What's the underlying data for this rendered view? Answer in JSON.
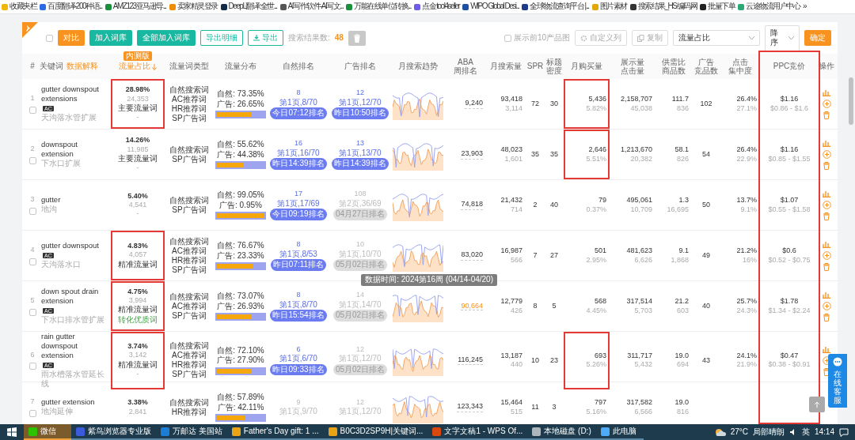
{
  "bookmarks": [
    {
      "label": "收藏夹栏",
      "color": "#f2b705"
    },
    {
      "label": "百度翻译-200种语...",
      "color": "#2d6be4"
    },
    {
      "label": "AMZ123亚马逊导...",
      "color": "#1a8f3c"
    },
    {
      "label": "卖家精灵登录",
      "color": "#f08c00"
    },
    {
      "label": "DeepL翻译:全世...",
      "color": "#0f2b46"
    },
    {
      "label": "AI写作软件-AI写文...",
      "color": "#555555"
    },
    {
      "label": "万能在线单位转换...",
      "color": "#1a8f3c"
    },
    {
      "label": "点金 tool4seller",
      "color": "#6c5ce7"
    },
    {
      "label": "WIPO Global Desi...",
      "color": "#1e4fa0"
    },
    {
      "label": "全球物流查询平台 |...",
      "color": "#1e3a8a"
    },
    {
      "label": "图片素材",
      "color": "#e0a800"
    },
    {
      "label": "搜索结果_HS编码网",
      "color": "#333333"
    },
    {
      "label": "批量下单",
      "color": "#222222"
    },
    {
      "label": "云途物流用户中心",
      "color": "#2aa876"
    }
  ],
  "bookmarks_more": "»",
  "toolbar": {
    "select_all": {
      "checked": false
    },
    "buttons": [
      {
        "label": "对比",
        "kind": "orange"
      },
      {
        "label": "加入词库",
        "kind": "teal"
      },
      {
        "label": "全部加入词库",
        "kind": "teal"
      },
      {
        "label": "导出明细",
        "kind": "outline"
      },
      {
        "label": "导出",
        "kind": "outline-download"
      }
    ],
    "result_label": "搜索结果数:",
    "result_count": "48",
    "show_images": {
      "label": "展示前10产品图",
      "checked": false
    },
    "custom_columns": "自定义列",
    "copy": "复制",
    "sort_field": "流量占比",
    "sort_order": "降序",
    "confirm": "确定"
  },
  "header": [
    {
      "lines": [
        "#"
      ]
    },
    {
      "lines": [
        "关键词"
      ],
      "extra": "数据解释"
    },
    {
      "lines": [
        "流量占比"
      ],
      "badge": "内测版",
      "sorted": true
    },
    {
      "lines": [
        "流量词类型"
      ]
    },
    {
      "lines": [
        "流量分布"
      ]
    },
    {
      "lines": [
        "自然排名"
      ]
    },
    {
      "lines": [
        "广告排名"
      ]
    },
    {
      "lines": [
        "月搜索趋势"
      ]
    },
    {
      "lines": [
        "ABA",
        "周排名"
      ]
    },
    {
      "lines": [
        "月搜索量"
      ]
    },
    {
      "lines": [
        "SPR"
      ]
    },
    {
      "lines": [
        "标题",
        "密度"
      ]
    },
    {
      "lines": [
        "月购买量"
      ]
    },
    {
      "lines": [
        "展示量",
        "点击量"
      ]
    },
    {
      "lines": [
        "供需比",
        "商品数"
      ]
    },
    {
      "lines": [
        "广告",
        "竞品数"
      ]
    },
    {
      "lines": [
        "点击",
        "集中度"
      ]
    },
    {
      "lines": [
        "PPC竞价"
      ],
      "marked": true
    },
    {
      "lines": [
        "操作"
      ]
    }
  ],
  "rows": [
    {
      "index": "1",
      "checked": false,
      "keyword": "gutter downspout extensions",
      "ac_badge": "AC",
      "keyword_cn": "天沟落水管扩展",
      "share": "28.98%",
      "share_count": "24,353",
      "traffic_label": "主要流量词",
      "extra": {
        "kind": "dash",
        "text": "-"
      },
      "share_marked": true,
      "types": [
        "自然搜索词",
        "AC推荐词",
        "HR推荐词",
        "SP广告词"
      ],
      "organic_label": "自然:",
      "organic": "73.35%",
      "ad_label": "广告:",
      "ad": "26.65%",
      "level": 0.7335,
      "natural_rank": {
        "rank": "8",
        "page": "第1页,8/70",
        "badge": "今日07:12排名",
        "current": true
      },
      "ad_rank": {
        "rank": "12",
        "page": "第1页,12/70",
        "badge": "昨日10:50排名",
        "current": true
      },
      "aba": "9,240",
      "search": "93,418",
      "search_sub": "3,114",
      "spr": "72",
      "title_density": "30",
      "buy": "5,436",
      "buy_rate": "5.82%",
      "buy_marked": true,
      "impressions": "2,158,707",
      "clicks": "45,038",
      "supply_ratio": "111.7",
      "products": "836",
      "ad_products": "102",
      "click_conc": "26.4%",
      "click_conc_sub": "27.1%",
      "ppc": "$1.16",
      "ppc_range": "$0.86 - $1.6"
    },
    {
      "index": "2",
      "checked": false,
      "keyword": "downspout extension",
      "keyword_cn": "下水口扩展",
      "share": "14.26%",
      "share_count": "11,985",
      "traffic_label": "主要流量词",
      "extra": {
        "kind": "dash",
        "text": "-"
      },
      "share_marked": false,
      "types": [
        "自然搜索词",
        "SP广告词"
      ],
      "organic_label": "自然:",
      "organic": "55.62%",
      "ad_label": "广告:",
      "ad": "44.38%",
      "level": 0.5562,
      "natural_rank": {
        "rank": "16",
        "page": "第1页,16/70",
        "badge": "昨日14:39排名",
        "current": true
      },
      "ad_rank": {
        "rank": "13",
        "page": "第1页,13/70",
        "badge": "昨日14:39排名",
        "current": true
      },
      "aba": "23,903",
      "search": "48,023",
      "search_sub": "1,601",
      "spr": "35",
      "title_density": "35",
      "buy": "2,646",
      "buy_rate": "5.51%",
      "buy_marked": true,
      "impressions": "1,213,670",
      "clicks": "20,382",
      "supply_ratio": "58.1",
      "products": "826",
      "ad_products": "54",
      "click_conc": "26.4%",
      "click_conc_sub": "22.9%",
      "ppc": "$1.16",
      "ppc_range": "$0.85 - $1.55"
    },
    {
      "index": "3",
      "checked": false,
      "keyword": "gutter",
      "keyword_cn": "地沟",
      "share": "5.40%",
      "share_count": "4,541",
      "extra": {
        "kind": "dash",
        "text": "-"
      },
      "share_marked": false,
      "types": [
        "自然搜索词",
        "SP广告词"
      ],
      "organic_label": "自然:",
      "organic": "99.05%",
      "ad_label": "广告:",
      "ad": "0.95%",
      "level": 0.9905,
      "natural_rank": {
        "rank": "17",
        "page": "第1页,17/69",
        "badge": "今日09:19排名",
        "current": true
      },
      "ad_rank": {
        "rank": "108",
        "page": "第2页,36/69",
        "badge": "04月27日排名",
        "current": false
      },
      "aba": "74,818",
      "search": "21,432",
      "search_sub": "714",
      "spr": "2",
      "title_density": "40",
      "buy": "79",
      "buy_rate": "0.37%",
      "buy_marked": false,
      "impressions": "495,061",
      "clicks": "10,709",
      "supply_ratio": "1.3",
      "products": "16,695",
      "ad_products": "50",
      "click_conc": "13.7%",
      "click_conc_sub": "9.1%",
      "ppc": "$1.07",
      "ppc_range": "$0.55 - $1.58"
    },
    {
      "index": "4",
      "checked": false,
      "keyword": "gutter downspout",
      "ac_badge": "AC",
      "keyword_cn": "天沟落水口",
      "share": "4.83%",
      "share_count": "4,057",
      "traffic_label": "精准流量词",
      "share_marked": true,
      "types": [
        "自然搜索词",
        "AC推荐词",
        "HR推荐词",
        "SP广告词"
      ],
      "organic_label": "自然:",
      "organic": "76.67%",
      "ad_label": "广告:",
      "ad": "23.33%",
      "level": 0.7667,
      "natural_rank": {
        "rank": "8",
        "page": "第1页,8/53",
        "badge": "昨日07:11排名",
        "current": true
      },
      "ad_rank": {
        "rank": "10",
        "page": "第1页,10/70",
        "badge": "05月02日排名",
        "current": false
      },
      "aba": "83,020",
      "search": "16,987",
      "search_sub": "566",
      "spr": "7",
      "title_density": "27",
      "buy": "501",
      "buy_rate": "2.95%",
      "buy_marked": false,
      "impressions": "481,623",
      "clicks": "6,626",
      "supply_ratio": "9.1",
      "products": "1,868",
      "ad_products": "49",
      "click_conc": "21.2%",
      "click_conc_sub": "16%",
      "ppc": "$0.6",
      "ppc_range": "$0.52 - $0.75"
    },
    {
      "index": "5",
      "checked": false,
      "keyword": "down spout drain extension",
      "ac_badge": "AC",
      "keyword_cn": "下水口排水管扩展",
      "share": "4.75%",
      "share_count": "3,994",
      "traffic_label": "精准流量词",
      "extra": {
        "kind": "quality",
        "text": "转化优质词"
      },
      "share_marked": true,
      "types": [
        "自然搜索词",
        "AC推荐词",
        "SP广告词"
      ],
      "organic_label": "自然:",
      "organic": "73.07%",
      "ad_label": "广告:",
      "ad": "26.93%",
      "level": 0.7307,
      "natural_rank": {
        "rank": "8",
        "page": "第1页,8/70",
        "badge": "昨日15:54排名",
        "current": true
      },
      "ad_rank": {
        "rank": "14",
        "page": "第1页,14/70",
        "badge": "05月02日排名",
        "current": false
      },
      "aba": "90,664",
      "aba_hovered": true,
      "aba_tooltip": "数据时间: 2024第16周 (04/14-04/20)",
      "search": "12,779",
      "search_sub": "426",
      "spr": "8",
      "title_density": "5",
      "buy": "568",
      "buy_rate": "4.45%",
      "buy_marked": false,
      "impressions": "317,514",
      "clicks": "5,703",
      "supply_ratio": "21.2",
      "products": "603",
      "ad_products": "40",
      "click_conc": "25.7%",
      "click_conc_sub": "24.3%",
      "ppc": "$1.78",
      "ppc_range": "$1.34 - $2.24"
    },
    {
      "index": "6",
      "checked": false,
      "keyword": "rain gutter downspout extension",
      "ac_badge": "AC",
      "keyword_cn": "雨水槽落水管延长线",
      "share": "3.74%",
      "share_count": "3,142",
      "traffic_label": "精准流量词",
      "extra": {
        "kind": "dash",
        "text": "-"
      },
      "share_marked": true,
      "types": [
        "自然搜索词",
        "AC推荐词",
        "HR推荐词",
        "SP广告词"
      ],
      "organic_label": "自然:",
      "organic": "72.10%",
      "ad_label": "广告:",
      "ad": "27.90%",
      "level": 0.721,
      "natural_rank": {
        "rank": "6",
        "page": "第1页,6/70",
        "badge": "昨日09:33排名",
        "current": true
      },
      "ad_rank": {
        "rank": "12",
        "page": "第1页,12/70",
        "badge": "05月02日排名",
        "current": false
      },
      "aba": "116,245",
      "search": "13,187",
      "search_sub": "440",
      "spr": "10",
      "title_density": "23",
      "buy": "693",
      "buy_rate": "5.26%",
      "buy_marked": true,
      "impressions": "311,717",
      "clicks": "5,432",
      "supply_ratio": "19.0",
      "products": "694",
      "ad_products": "43",
      "click_conc": "24.1%",
      "click_conc_sub": "21.9%",
      "ppc": "$0.47",
      "ppc_range": "$0.38 - $0.91"
    },
    {
      "index": "7",
      "checked": false,
      "keyword": "gutter extension",
      "keyword_cn": "地沟延伸",
      "share": "3.38%",
      "share_count": "2,841",
      "share_marked": false,
      "types": [
        "自然搜索词",
        "HR推荐词"
      ],
      "organic_label": "自然:",
      "organic": "57.89%",
      "ad_label": "广告:",
      "ad": "42.11%",
      "level": 0.5789,
      "natural_rank": {
        "rank": "9",
        "page": "第1页,9/70",
        "current": false
      },
      "ad_rank": {
        "rank": "12",
        "page": "第1页,12/70",
        "current": false
      },
      "aba": "123,343",
      "search": "15,464",
      "search_sub": "515",
      "spr": "11",
      "title_density": "3",
      "buy": "797",
      "buy_rate": "5.16%",
      "buy_marked": false,
      "impressions": "317,582",
      "clicks": "6,566",
      "supply_ratio": "19.0",
      "products": "816"
    }
  ],
  "chat_button": "在线客服",
  "taskbar": {
    "items": [
      {
        "label": "微信",
        "active": true,
        "color": "#2dc100"
      },
      {
        "label": "紫鸟浏览器专业版",
        "active": false,
        "color": "#3b5bdb"
      },
      {
        "label": "万邮达 美国站",
        "active": false,
        "color": "#1c7ed6"
      },
      {
        "label": "Father's Day gift: 1 ...",
        "active": false,
        "color": "#e8a317"
      },
      {
        "label": "B0C3D2SP9H|关键词...",
        "active": false,
        "color": "#e8a317"
      },
      {
        "label": "文字文稿1 - WPS Of...",
        "active": false,
        "color": "#d9480f"
      },
      {
        "label": "本地磁盘 (D:)",
        "active": false,
        "color": "#adb5bd"
      },
      {
        "label": "此电脑",
        "active": false,
        "color": "#4dabf7"
      }
    ],
    "temperature": "27°C",
    "weather": "局部晴朗",
    "ime": "英",
    "time": "14:14"
  }
}
